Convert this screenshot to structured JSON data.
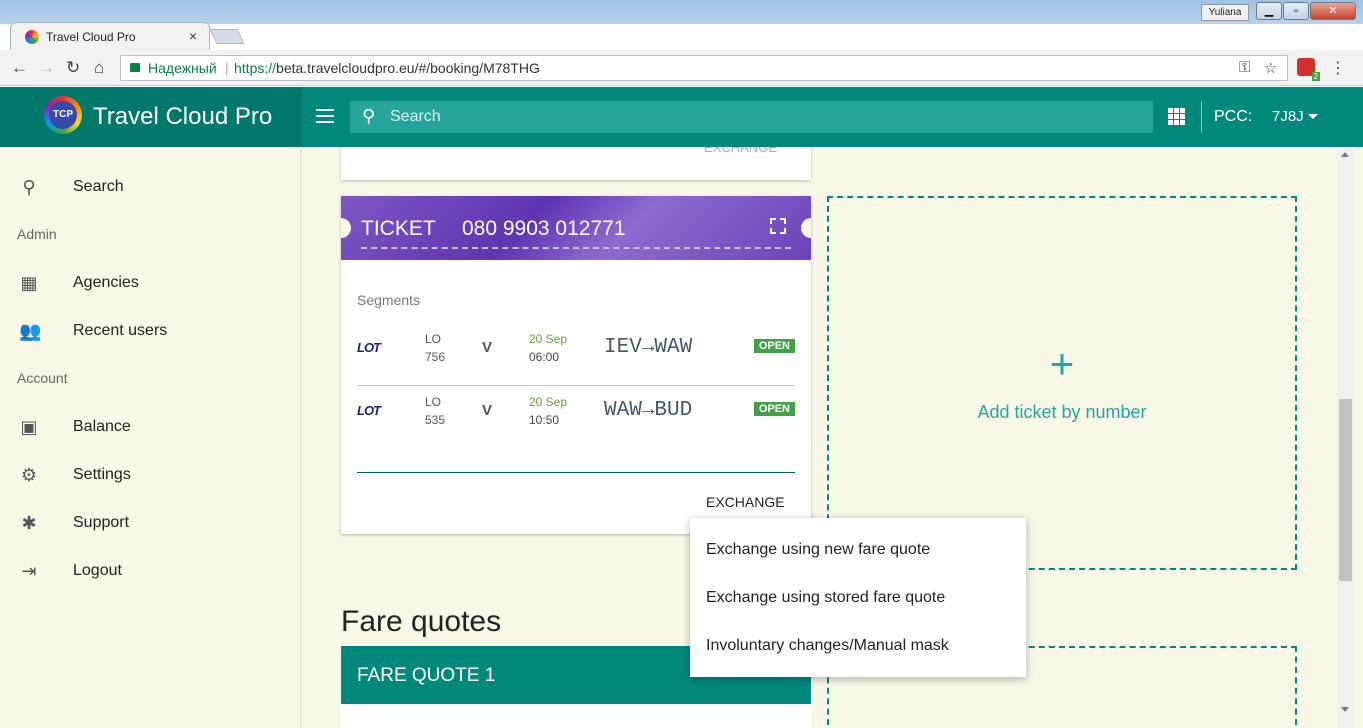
{
  "browser": {
    "tab_title": "Travel Cloud Pro",
    "tab_close": "×",
    "user": "Yuliana",
    "secure_label": "Надежный",
    "url_scheme": "https://",
    "url_rest": "beta.travelcloudpro.eu/#/booking/M78THG",
    "extension_badge": "2"
  },
  "app": {
    "brand": "Travel Cloud Pro",
    "logo_text": "TCP",
    "search_placeholder": "Search",
    "pcc_label": "PCC:",
    "pcc_value": "7J8J"
  },
  "sidebar": {
    "search": "Search",
    "admin_section": "Admin",
    "agencies": "Agencies",
    "recent_users": "Recent users",
    "account_section": "Account",
    "balance": "Balance",
    "settings": "Settings",
    "support": "Support",
    "logout": "Logout"
  },
  "prev_card": {
    "action": "EXCHANGE"
  },
  "ticket": {
    "label": "TICKET",
    "number": "080 9903 012771",
    "segments_label": "Segments",
    "segments": [
      {
        "logo": "LOT",
        "carrier": "LO",
        "flight": "756",
        "class": "V",
        "date": "20 Sep",
        "time": "06:00",
        "route": "IEV→WAW",
        "status": "OPEN"
      },
      {
        "logo": "LOT",
        "carrier": "LO",
        "flight": "535",
        "class": "V",
        "date": "20 Sep",
        "time": "10:50",
        "route": "WAW→BUD",
        "status": "OPEN"
      }
    ],
    "action": "EXCHANGE"
  },
  "add_ticket": {
    "icon": "+",
    "label": "Add ticket by number"
  },
  "exchange_menu": [
    "Exchange using new fare quote",
    "Exchange using stored fare quote",
    "Involuntary changes/Manual mask"
  ],
  "fare_quotes": {
    "title": "Fare quotes",
    "card_title": "FARE QUOTE 1"
  },
  "colors": {
    "primary": "#00897b",
    "primary_dark": "#00796b",
    "ticket_header": "#7e57c2",
    "status_open": "#43a047",
    "background": "#f8f8e6"
  }
}
